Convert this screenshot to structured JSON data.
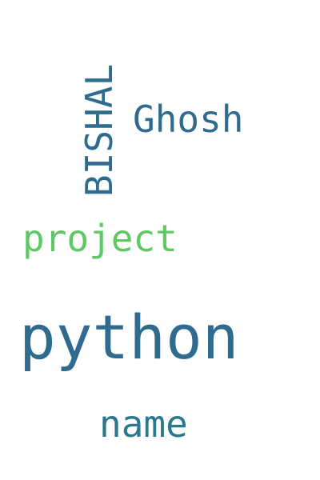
{
  "words": [
    {
      "key": "python",
      "text": "python",
      "color": "#2e6b8e"
    },
    {
      "key": "bishal",
      "text": "BISHAL",
      "color": "#2e6b8e"
    },
    {
      "key": "ghosh",
      "text": "Ghosh",
      "color": "#2e6b8e"
    },
    {
      "key": "project",
      "text": "project",
      "color": "#5ec962"
    },
    {
      "key": "name",
      "text": "name",
      "color": "#2a788e"
    }
  ],
  "background": "#ffffff"
}
